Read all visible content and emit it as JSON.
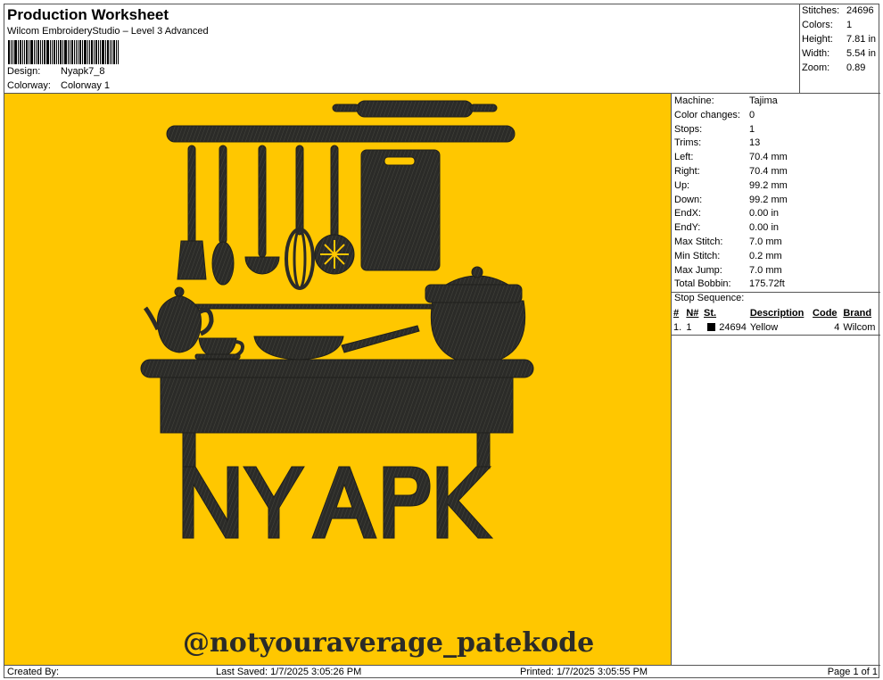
{
  "header": {
    "title": "Production Worksheet",
    "subtitle": "Wilcom EmbroideryStudio – Level 3 Advanced",
    "design_label": "Design:",
    "design_value": "Nyapk7_8",
    "colorway_label": "Colorway:",
    "colorway_value": "Colorway 1"
  },
  "stats": {
    "stitches_label": "Stitches:",
    "stitches_value": "24696",
    "colors_label": "Colors:",
    "colors_value": "1",
    "height_label": "Height:",
    "height_value": "7.81 in",
    "width_label": "Width:",
    "width_value": "5.54 in",
    "zoom_label": "Zoom:",
    "zoom_value": "0.89"
  },
  "machine_info": [
    {
      "label": "Machine:",
      "value": "Tajima"
    },
    {
      "label": "Color changes:",
      "value": "0"
    },
    {
      "label": "Stops:",
      "value": "1"
    },
    {
      "label": "Trims:",
      "value": "13"
    },
    {
      "label": "Left:",
      "value": "70.4 mm"
    },
    {
      "label": "Right:",
      "value": "70.4 mm"
    },
    {
      "label": "Up:",
      "value": "99.2 mm"
    },
    {
      "label": "Down:",
      "value": "99.2 mm"
    },
    {
      "label": "EndX:",
      "value": "0.00 in"
    },
    {
      "label": "EndY:",
      "value": "0.00 in"
    },
    {
      "label": "Max Stitch:",
      "value": "7.0 mm"
    },
    {
      "label": "Min Stitch:",
      "value": "0.2 mm"
    },
    {
      "label": "Max Jump:",
      "value": "7.0 mm"
    },
    {
      "label": "Total Bobbin:",
      "value": "175.72ft"
    }
  ],
  "stop_sequence": {
    "title": "Stop Sequence:",
    "columns": [
      "#",
      "N#",
      "St.",
      "Description",
      "Code",
      "Brand"
    ],
    "rows": [
      {
        "num": "1.",
        "n": "1",
        "st": "24694",
        "desc": "Yellow",
        "code": "4",
        "brand": "Wilcom"
      }
    ]
  },
  "design": {
    "background_color": "#ffc700",
    "stitch_color": "#2b2b28",
    "logo_text": "NYAPK",
    "handle_text": "@notyouraverage_patekode"
  },
  "footer": {
    "created_by": "Created By:",
    "last_saved": "Last Saved: 1/7/2025 3:05:26 PM",
    "printed": "Printed: 1/7/2025 3:05:55 PM",
    "page": "Page 1 of 1"
  }
}
